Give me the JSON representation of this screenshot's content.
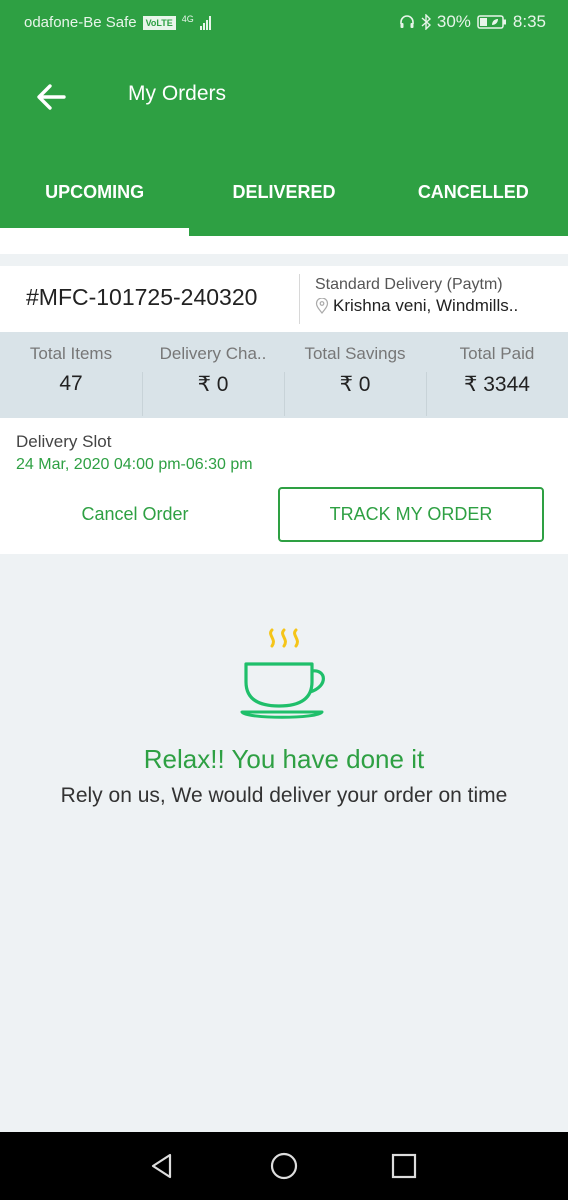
{
  "status_bar": {
    "carrier": "odafone-Be Safe",
    "volte": "VoLTE",
    "network": "4G",
    "battery": "30%",
    "time": "8:35"
  },
  "app_bar": {
    "title": "My Orders"
  },
  "tabs": [
    {
      "label": "UPCOMING",
      "active": true
    },
    {
      "label": "DELIVERED",
      "active": false
    },
    {
      "label": "CANCELLED",
      "active": false
    }
  ],
  "order": {
    "id": "#MFC-101725-240320",
    "delivery_type": "Standard Delivery (Paytm)",
    "address": "Krishna veni, Windmills..",
    "summary": [
      {
        "label": "Total Items",
        "value": "47"
      },
      {
        "label": "Delivery Cha..",
        "value": "₹ 0"
      },
      {
        "label": "Total Savings",
        "value": "₹ 0"
      },
      {
        "label": "Total Paid",
        "value": "₹ 3344"
      }
    ],
    "slot_label": "Delivery Slot",
    "slot_value": "24 Mar, 2020 04:00 pm-06:30 pm",
    "cancel_label": "Cancel Order",
    "track_label": "TRACK MY ORDER"
  },
  "empty_state": {
    "icon": "coffee-cup-icon",
    "title": "Relax!! You have done it",
    "subtitle": "Rely on us, We would deliver your order on time"
  },
  "colors": {
    "brand_green": "#2ea043",
    "cup_green": "#1fbf6a",
    "steam_yellow": "#f5c518"
  }
}
